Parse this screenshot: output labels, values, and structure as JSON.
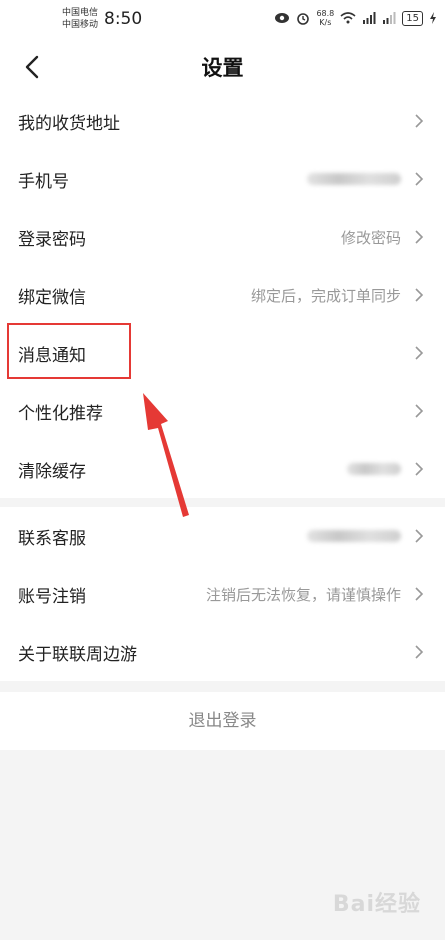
{
  "status_bar": {
    "carrier_1": "中国电信",
    "carrier_2": "中国移动",
    "time": "8:50",
    "speed_value": "68.8",
    "speed_unit": "K/s",
    "battery": "15",
    "icons": [
      "eye-icon",
      "alarm-icon",
      "wifi-icon",
      "signal-icon",
      "signal-icon",
      "battery-icon",
      "charging-icon"
    ]
  },
  "header": {
    "title": "设置"
  },
  "group1": [
    {
      "label": "我的收货地址",
      "value": ""
    },
    {
      "label": "手机号",
      "value": ""
    },
    {
      "label": "登录密码",
      "value": "修改密码"
    },
    {
      "label": "绑定微信",
      "value": "绑定后，完成订单同步"
    },
    {
      "label": "消息通知",
      "value": ""
    },
    {
      "label": "个性化推荐",
      "value": ""
    },
    {
      "label": "清除缓存",
      "value": ""
    }
  ],
  "group2": [
    {
      "label": "联系客服",
      "value": ""
    },
    {
      "label": "账号注销",
      "value": "注销后无法恢复，请谨慎操作"
    },
    {
      "label": "关于联联周边游",
      "value": ""
    }
  ],
  "logout_label": "退出登录",
  "watermark": "Bai经验",
  "colors": {
    "annotation_red": "#e53935",
    "page_bg": "#f4f4f4",
    "card_bg": "#ffffff"
  }
}
